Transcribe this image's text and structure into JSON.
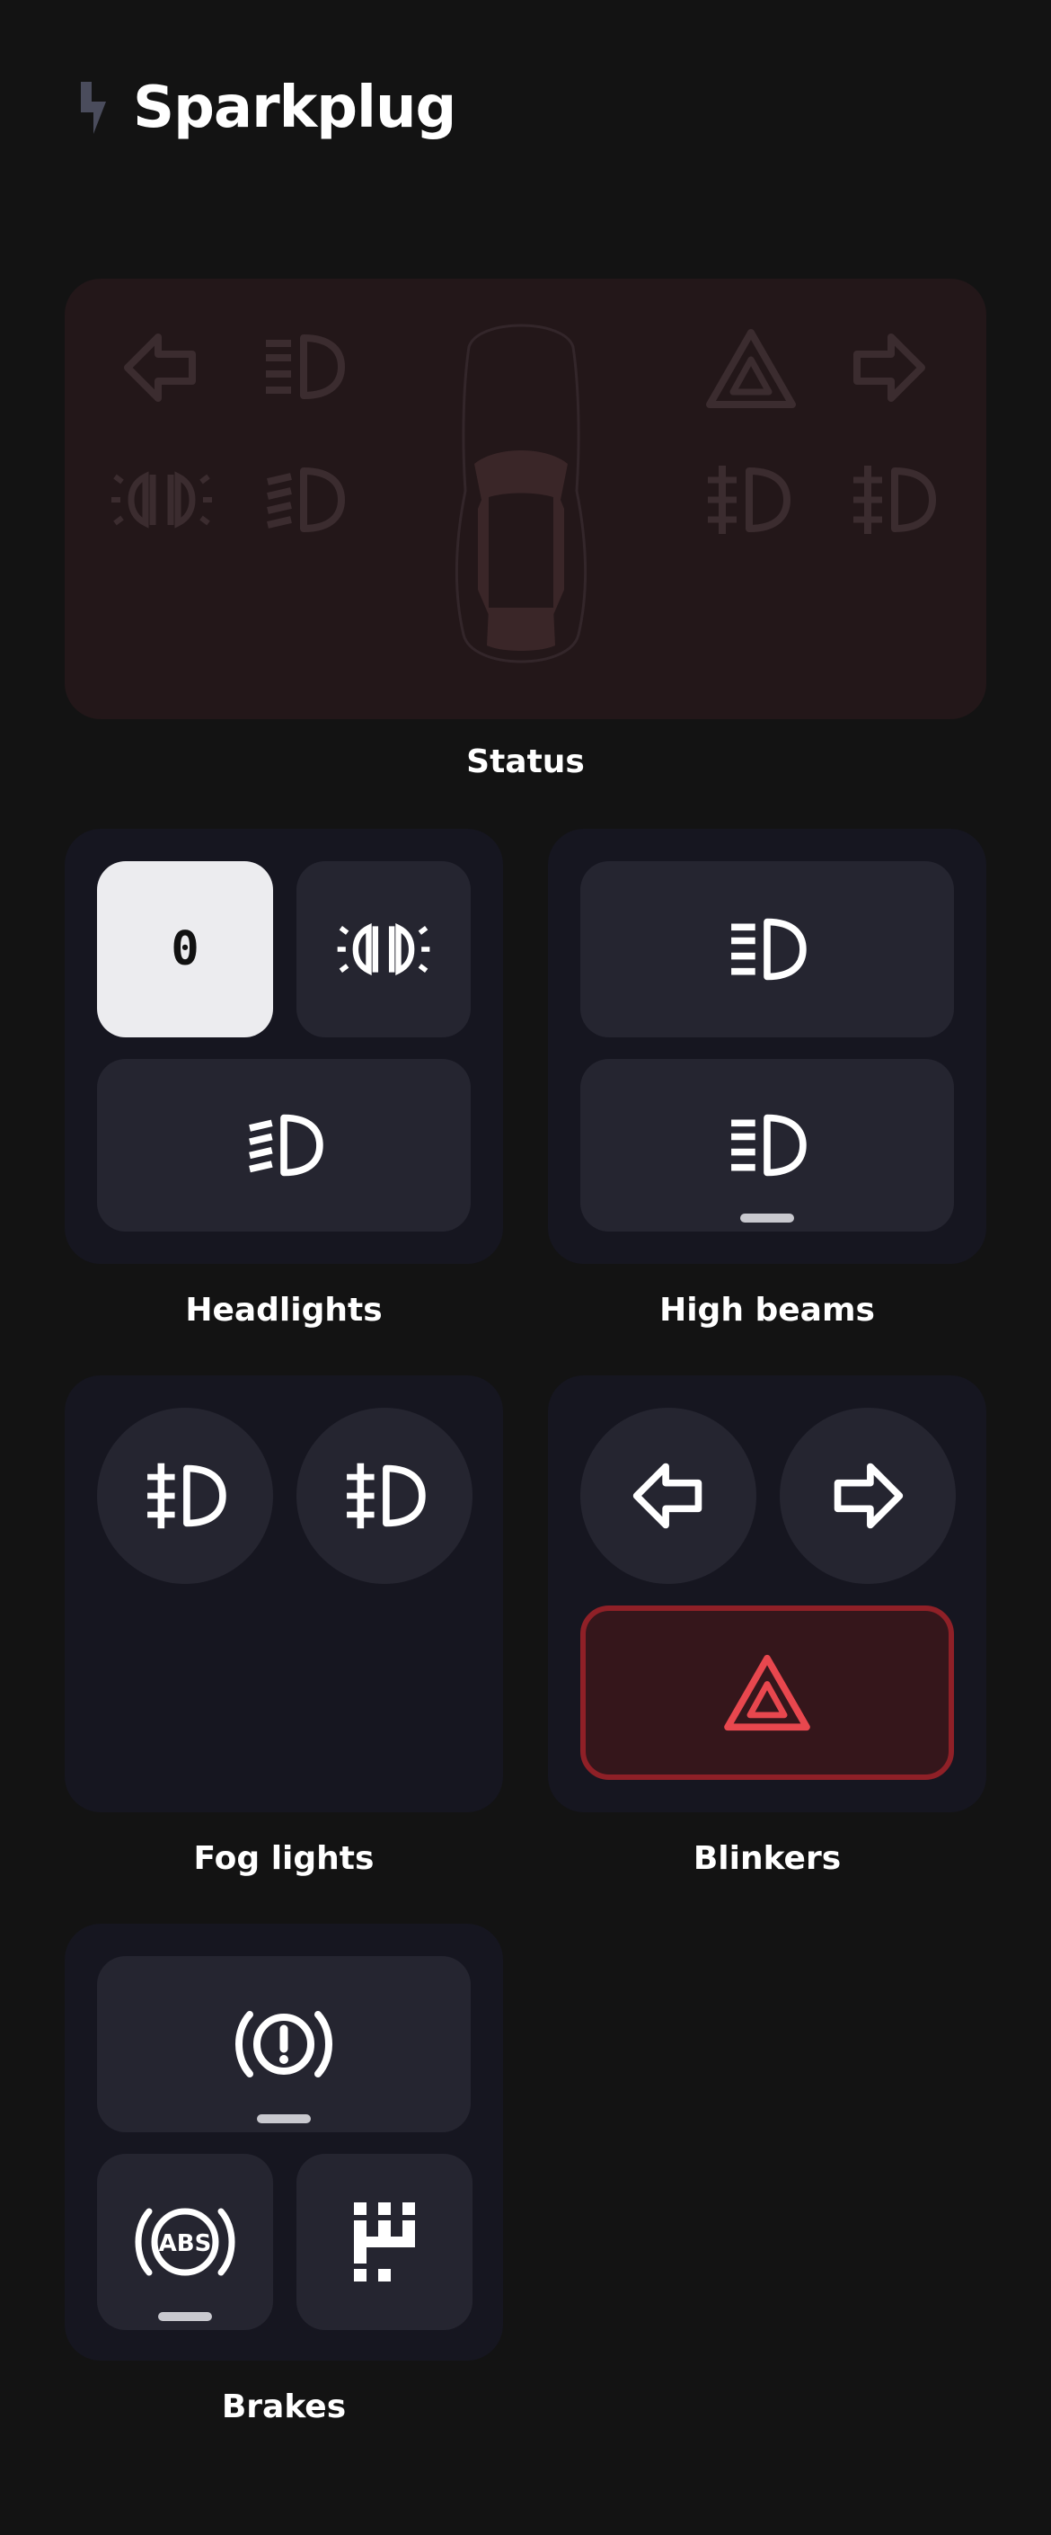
{
  "header": {
    "brand": "Sparkplug",
    "logo_icon": "bolt-icon"
  },
  "colors": {
    "background": "#131313",
    "status_panel": "#231719",
    "card": "#161620",
    "tile": "#252530",
    "tile_active": "#ececef",
    "hazard_fill": "#35161b",
    "hazard_border": "#8f2027",
    "hazard_icon": "#e8474e",
    "indicator": "#c9c9cf"
  },
  "status": {
    "label": "Status",
    "indicators": [
      "left-arrow-icon",
      "high-beam-icon",
      "hazard-icon",
      "right-arrow-icon",
      "parking-light-icon",
      "low-beam-icon",
      "fog-light-icon",
      "fog-light-icon"
    ],
    "car_icon": "car-top-view-icon",
    "state": "inactive"
  },
  "headlights": {
    "label": "Headlights",
    "level_value": "0",
    "tiles": [
      {
        "icon": "level-value",
        "active": true
      },
      {
        "icon": "parking-light-icon",
        "active": false
      },
      {
        "icon": "low-beam-icon",
        "active": false
      }
    ]
  },
  "high_beams": {
    "label": "High beams",
    "tiles": [
      {
        "icon": "high-beam-icon",
        "indicator": false
      },
      {
        "icon": "high-beam-icon",
        "indicator": true
      }
    ]
  },
  "fog_lights": {
    "label": "Fog lights",
    "tiles": [
      {
        "icon": "fog-light-icon"
      },
      {
        "icon": "fog-light-icon"
      }
    ]
  },
  "blinkers": {
    "label": "Blinkers",
    "tiles": [
      {
        "icon": "left-arrow-icon"
      },
      {
        "icon": "right-arrow-icon"
      },
      {
        "icon": "hazard-icon",
        "active": true
      }
    ]
  },
  "brakes": {
    "label": "Brakes",
    "tiles": [
      {
        "icon": "brake-warning-icon",
        "indicator": true
      },
      {
        "icon": "abs-icon",
        "indicator": true
      },
      {
        "icon": "gear-shift-icon",
        "indicator": false
      }
    ],
    "abs_text": "ABS"
  }
}
